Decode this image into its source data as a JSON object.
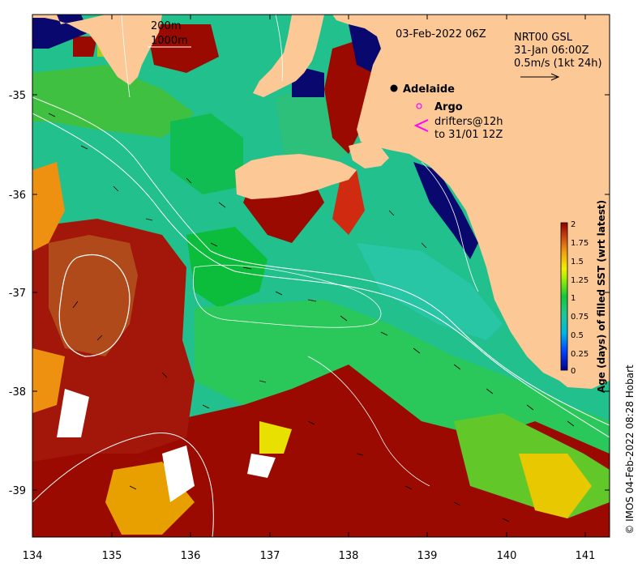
{
  "map": {
    "date_title": "03-Feb-2022 06Z",
    "product_lines": [
      "NRT00 GSL",
      "31-Jan 06:00Z",
      "0.5m/s (1kt 24h)"
    ],
    "contour_legend": [
      "200m",
      "1000m"
    ],
    "place_label": "Adelaide",
    "argo_label": "Argo",
    "drifter_legend": [
      "drifters@12h",
      "to 31/01 12Z"
    ],
    "credit": "© IMOS 04-Feb-2022 08:28 Hobart",
    "x_ticks": [
      "134",
      "135",
      "136",
      "137",
      "138",
      "139",
      "140",
      "141"
    ],
    "y_ticks": [
      "-35",
      "-36",
      "-37",
      "-38",
      "-39"
    ],
    "extent": {
      "lon": [
        134,
        141.3
      ],
      "lat": [
        -39.47,
        -34.18
      ]
    },
    "colors": {
      "land": "#fcc896",
      "deep_blue": "#08086e",
      "dark_red": "#9a0a00",
      "contour": "#ffffff",
      "argo_marker": "#ff00ff",
      "drifter_marker": "#ff00ff"
    }
  },
  "colorbar": {
    "label": "Age (days) of filled SST (wrt latest)",
    "ticks": [
      "2",
      "1.75",
      "1.5",
      "1.25",
      "1",
      "0.75",
      "0.5",
      "0.25",
      "0"
    ],
    "range": [
      0,
      2
    ]
  }
}
